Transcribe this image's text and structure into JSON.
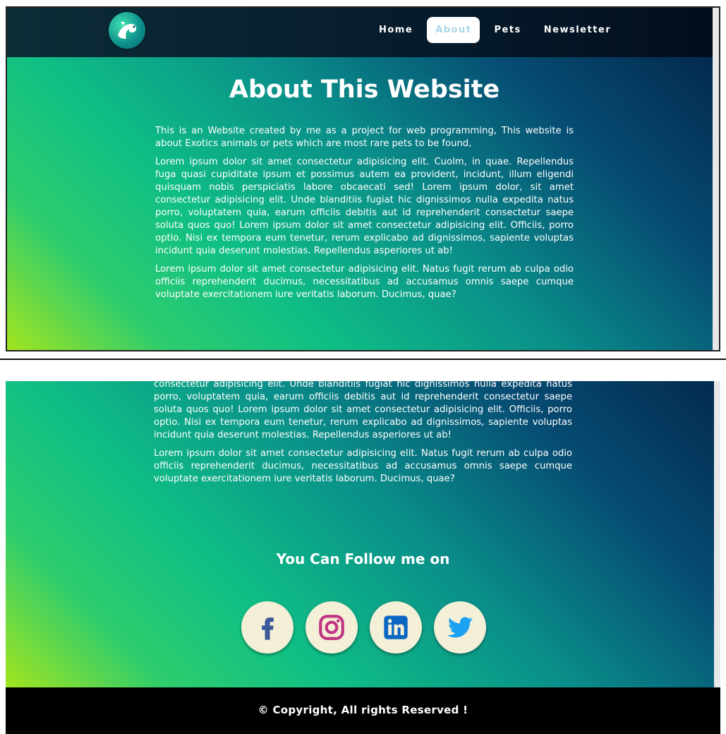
{
  "nav": {
    "links": [
      {
        "label": "Home"
      },
      {
        "label": "About"
      },
      {
        "label": "Pets"
      },
      {
        "label": "Newsletter"
      }
    ]
  },
  "main": {
    "title": "About This Website",
    "intro": "This is an Website created by me as a project for web programming, This website is about Exotics animals or pets which are most rare pets to be found,",
    "para1": "Lorem ipsum dolor sit amet consectetur adipisicing elit. Cuolm, in quae. Repellendus fuga quasi cupiditate ipsum et possimus autem ea provident, incidunt, illum eligendi quisquam nobis perspiciatis labore obcaecati sed! Lorem ipsum dolor, sit amet consectetur adipisicing elit. Unde blanditiis fugiat hic dignissimos nulla expedita natus porro, voluptatem quia, earum officiis debitis aut id reprehenderit consectetur saepe soluta quos quo! Lorem ipsum dolor sit amet consectetur adipisicing elit. Officiis, porro optio. Nisi ex tempora eum tenetur, rerum explicabo ad dignissimos, sapiente voluptas incidunt quia deserunt molestias. Repellendus asperiores ut ab!",
    "para1_cont": "consectetur adipisicing elit. Unde blanditiis fugiat hic dignissimos nulla expedita natus porro, voluptatem quia, earum officiis debitis aut id reprehenderit consectetur saepe soluta quos quo! Lorem ipsum dolor sit amet consectetur adipisicing elit. Officiis, porro optio. Nisi ex tempora eum tenetur, rerum explicabo ad dignissimos, sapiente voluptas incidunt quia deserunt molestias. Repellendus asperiores ut ab!",
    "para2": "Lorem ipsum dolor sit amet consectetur adipisicing elit. Natus fugit rerum ab culpa odio officiis reprehenderit ducimus, necessitatibus ad accusamus omnis saepe cumque voluptate exercitationem iure veritatis laborum. Ducimus, quae?",
    "follow_heading": "You Can Follow me on"
  },
  "socials": [
    {
      "icon": "facebook-icon",
      "color": "#3b5998"
    },
    {
      "icon": "instagram-icon",
      "color": "#c13584"
    },
    {
      "icon": "linkedin-icon",
      "color": "#0a66c2"
    },
    {
      "icon": "twitter-icon",
      "color": "#1da1f2"
    }
  ],
  "footer": {
    "copyright": "© Copyright, All rights Reserved !"
  }
}
